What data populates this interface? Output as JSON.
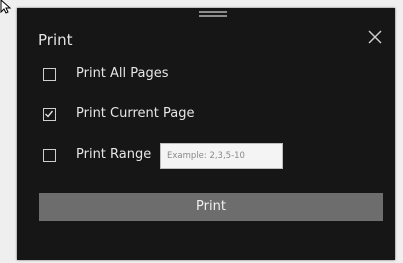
{
  "dialog": {
    "title": "Print",
    "close_icon": "close-icon",
    "grabber_icon": "drag-handle-icon"
  },
  "options": [
    {
      "label": "Print All Pages",
      "checked": false
    },
    {
      "label": "Print Current Page",
      "checked": true
    },
    {
      "label": "Print Range",
      "checked": false
    }
  ],
  "range": {
    "placeholder": "Example: 2,3,5-10",
    "value": ""
  },
  "print_button": {
    "label": "Print"
  },
  "colors": {
    "dialog_background": "#161616",
    "button_background": "#6d6d6d",
    "text": "#e6e6e6"
  }
}
